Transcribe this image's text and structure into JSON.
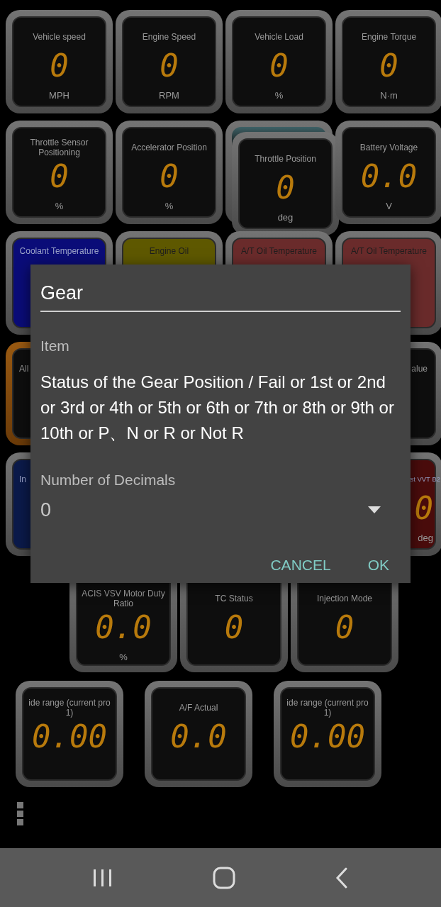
{
  "gauge_rows": [
    {
      "gauges": [
        {
          "kind": "gauge",
          "title": "Vehicle speed",
          "value": "0",
          "unit": "MPH"
        },
        {
          "kind": "gauge",
          "title": "Engine Speed",
          "value": "0",
          "unit": "RPM"
        },
        {
          "kind": "gauge",
          "title": "Vehicle Load",
          "value": "0",
          "unit": "%"
        },
        {
          "kind": "gauge",
          "title": "Engine Torque",
          "value": "0",
          "unit": "N·m"
        }
      ]
    },
    {
      "gauges": [
        {
          "kind": "gauge",
          "title": "Throttle Sensor Positioning",
          "value": "0",
          "unit": "%"
        },
        {
          "kind": "gauge",
          "title": "Accelerator Position",
          "value": "0",
          "unit": "%"
        },
        {
          "kind": "dragged",
          "title": "Throttle Position",
          "value": "0",
          "unit": "deg"
        },
        {
          "kind": "gauge",
          "title": "Battery Voltage",
          "value": "0.0",
          "unit": "V"
        }
      ]
    },
    {
      "gauges": [
        {
          "kind": "gauge",
          "title": "Coolant Temperature",
          "color": "#0a0c78"
        },
        {
          "kind": "gauge",
          "title": "Engine Oil",
          "color": "#5e5800"
        },
        {
          "kind": "gauge",
          "title": "A/T Oil Temperature",
          "color": "#6a2b2b"
        },
        {
          "kind": "gauge",
          "title": "A/T Oil Temperature",
          "color": "#6a2b2b"
        }
      ]
    },
    {
      "gauges": [
        {
          "kind": "highlighted",
          "title": "All"
        },
        {
          "kind": "gauge",
          "title": "alue"
        }
      ]
    },
    {
      "gauges": [
        {
          "kind": "gauge",
          "title": "In",
          "color": "#0b1a4a"
        },
        {
          "kind": "gauge",
          "title": "st VVT B2",
          "value": "0",
          "unit": "deg",
          "color": "#4a0c0c"
        }
      ]
    },
    {
      "gauges": [
        {
          "kind": "gauge",
          "title": "ACIS VSV Motor Duty Ratio",
          "value": "0.0",
          "unit": "%"
        },
        {
          "kind": "gauge",
          "title": "TC Status",
          "value": "0"
        },
        {
          "kind": "gauge",
          "title": "Injection Mode",
          "value": "0"
        }
      ]
    },
    {
      "gauges": [
        {
          "kind": "gauge",
          "title": "ide range (current pro 1)",
          "value": "0.00"
        },
        {
          "kind": "gauge",
          "title": "A/F Actual",
          "value": "0.0"
        },
        {
          "kind": "gauge",
          "title": "ide range (current pro 1)",
          "value": "0.00"
        }
      ]
    }
  ],
  "dialog": {
    "title": "Gear",
    "item_label": "Item",
    "item_text": "Status of the Gear Position / Fail or 1st or 2nd or 3rd or 4th or 5th or 6th or 7th or 8th or 9th or 10th or P、N or R or Not R",
    "decimals_label": "Number of Decimals",
    "decimals_value": "0",
    "buttons": [
      "CANCEL",
      "OK"
    ]
  }
}
